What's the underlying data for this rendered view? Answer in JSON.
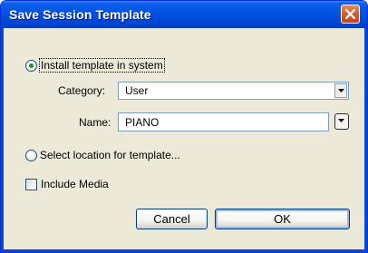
{
  "window": {
    "title": "Save Session Template",
    "close_icon": "close-icon"
  },
  "options": {
    "install_label": "Install template in system",
    "install_selected": true,
    "category_label": "Category:",
    "category_value": "User",
    "name_label": "Name:",
    "name_value": "PIANO",
    "select_location_label": "Select location for template...",
    "include_media_label": "Include Media",
    "include_media_checked": false
  },
  "buttons": {
    "cancel_label": "Cancel",
    "ok_label": "OK"
  },
  "colors": {
    "title_bar": "#0053e1",
    "dialog_bg": "#ece9d8",
    "close_button": "#d65a2a"
  }
}
